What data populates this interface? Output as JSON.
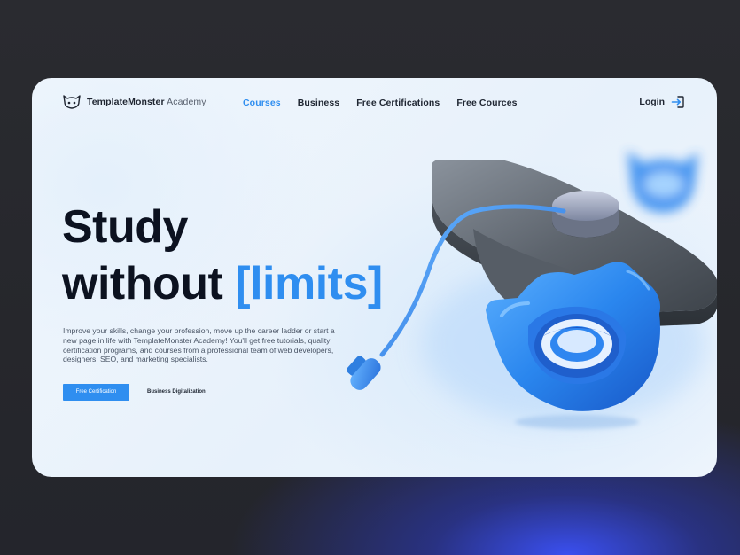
{
  "brand": {
    "name_bold": "TemplateMonster",
    "name_light": "Academy",
    "accent_color": "#2f8ef0"
  },
  "nav": {
    "items": [
      {
        "label": "Courses",
        "active": true
      },
      {
        "label": "Business",
        "active": false
      },
      {
        "label": "Free Certifications",
        "active": false
      },
      {
        "label": "Free Cources",
        "active": false
      }
    ]
  },
  "header": {
    "login_label": "Login",
    "login_icon": "login-arrow-icon"
  },
  "hero": {
    "title_line1": "Study",
    "title_line2_prefix": "without ",
    "title_line2_accent": "[limits]",
    "description": "Improve your skills, change your profession, move up the career ladder or start a new page in life with TemplateMonster Academy! You'll get free tutorials, quality certification programs, and courses from a professional team of web developers, designers, SEO, and marketing specialists.",
    "primary_button": "Free Certification",
    "secondary_button": "Business Digitalization"
  }
}
